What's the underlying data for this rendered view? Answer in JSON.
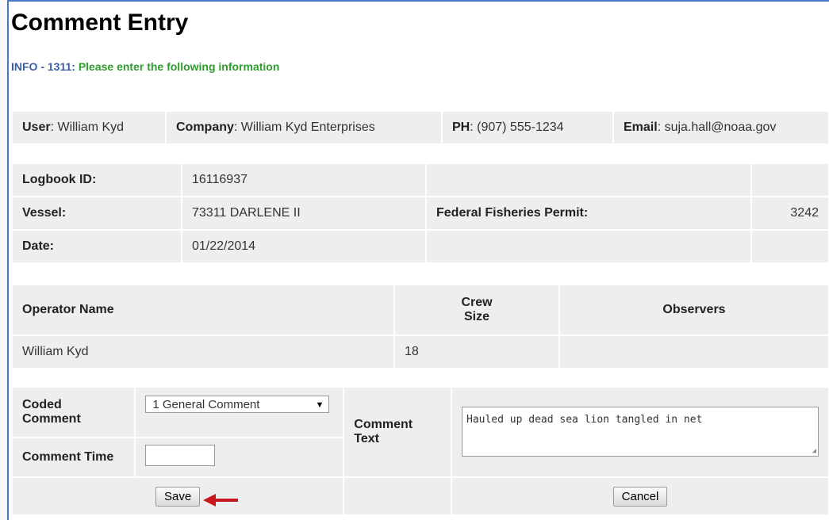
{
  "title": "Comment Entry",
  "info": {
    "code": "INFO - 1311:",
    "message": "Please enter the following information"
  },
  "user_bar": {
    "user_label": "User",
    "user_value": "William Kyd",
    "company_label": "Company",
    "company_value": "William Kyd Enterprises",
    "phone_label": "PH",
    "phone_value": "(907) 555-1234",
    "email_label": "Email",
    "email_value": "suja.hall@noaa.gov"
  },
  "logbook": {
    "id_label": "Logbook ID:",
    "id_value": "16116937",
    "vessel_label": "Vessel:",
    "vessel_value": "73311 DARLENE II",
    "permit_label": "Federal Fisheries Permit:",
    "permit_value": "3242",
    "date_label": "Date:",
    "date_value": "01/22/2014"
  },
  "operator": {
    "headers": {
      "name": "Operator Name",
      "crew": "Crew Size",
      "observers": "Observers"
    },
    "row": {
      "name": "William Kyd",
      "crew": "18",
      "observers": ""
    }
  },
  "comment": {
    "coded_label": "Coded Comment",
    "coded_value": "1 General Comment",
    "time_label": "Comment Time",
    "time_value": "",
    "text_label": "Comment Text",
    "text_value": "Hauled up dead sea lion tangled in net"
  },
  "buttons": {
    "save": "Save",
    "cancel": "Cancel"
  },
  "colors": {
    "accent": "#4a78c4",
    "info_code": "#3a5fa8",
    "info_msg": "#2e9b2e",
    "arrow": "#c8161d",
    "cell_bg": "#eeeeee"
  },
  "icons": {
    "dropdown": "chevron-down-icon",
    "pointer": "red-arrow-icon"
  }
}
